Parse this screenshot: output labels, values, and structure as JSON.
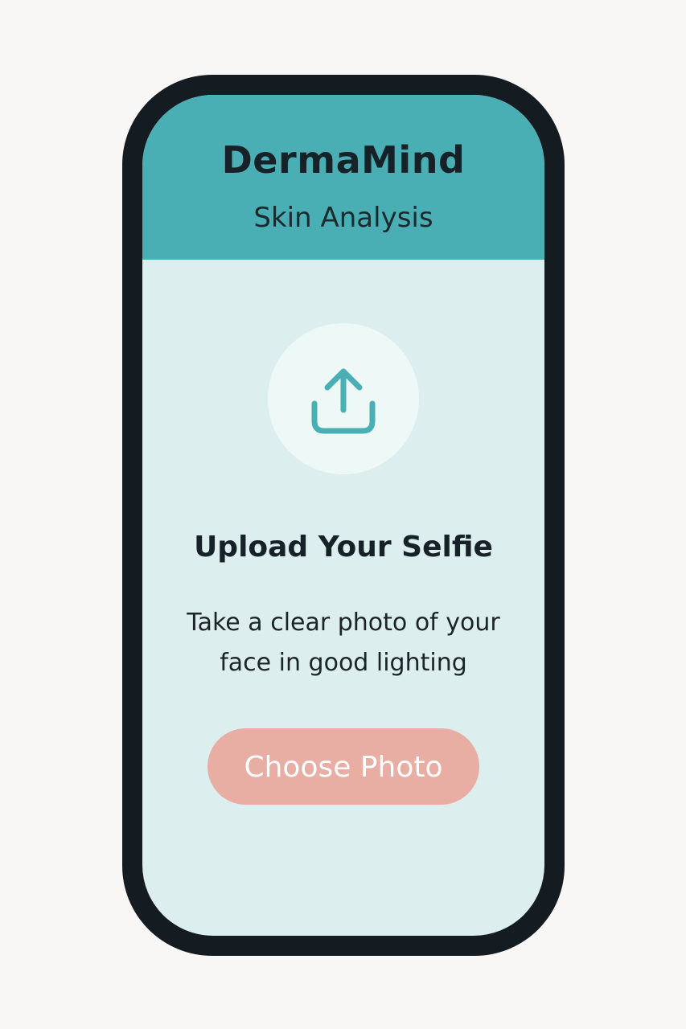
{
  "header": {
    "title": "DermaMind",
    "subtitle": "Skin Analysis"
  },
  "upload": {
    "icon": "upload-icon",
    "title": "Upload Your Selfie",
    "description_line1": "Take a clear photo of your",
    "description_line2": "face in good lighting",
    "button_label": "Choose Photo"
  },
  "colors": {
    "header_bg": "#4aafb5",
    "screen_bg": "#ddeeee",
    "accent": "#4aafb5",
    "button_bg": "#e8ada3",
    "frame": "#141b21"
  }
}
